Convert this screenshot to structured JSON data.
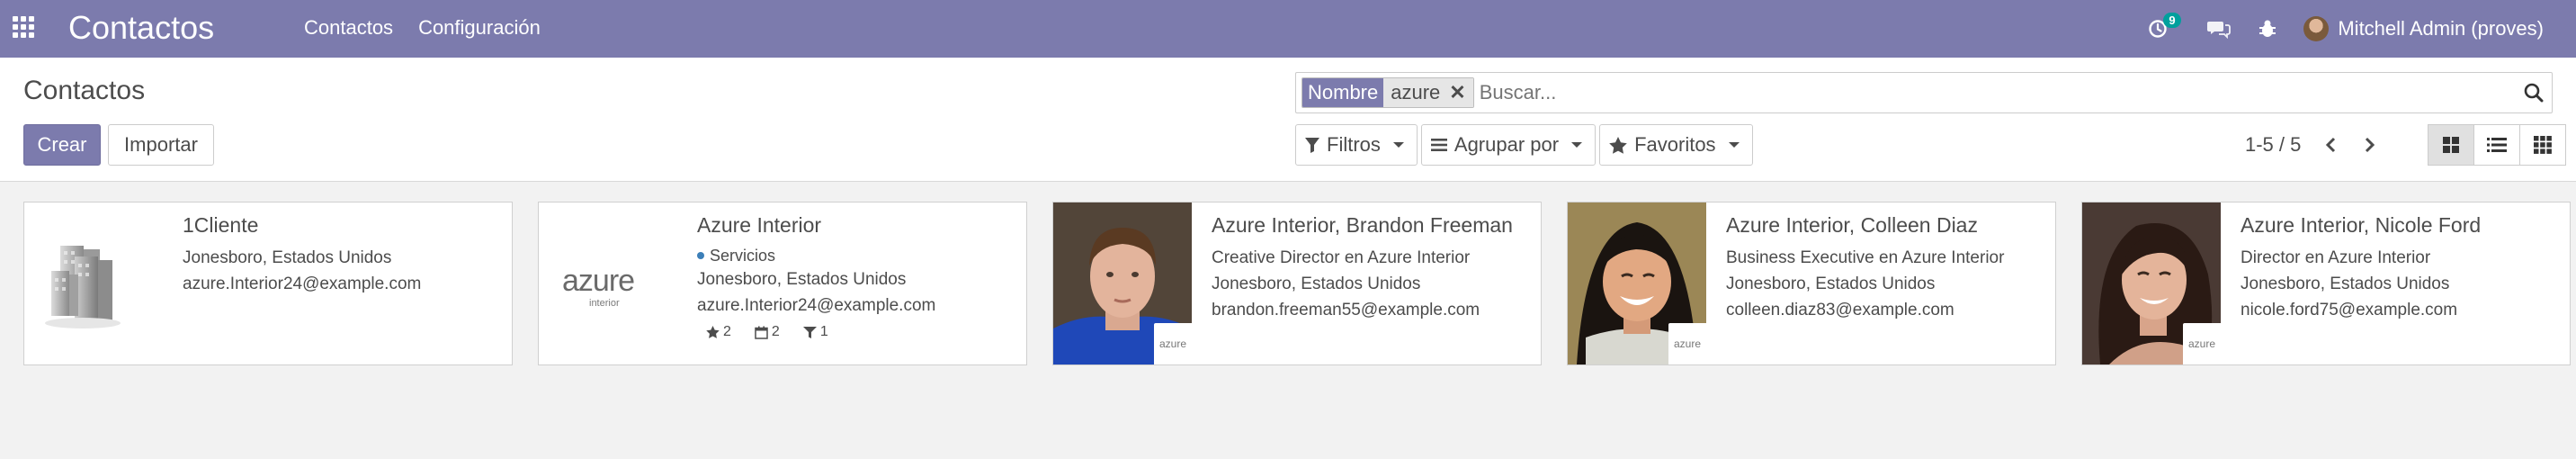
{
  "navbar": {
    "brand": "Contactos",
    "menu": [
      "Contactos",
      "Configuración"
    ],
    "activity_badge": "9",
    "user_name": "Mitchell Admin (proves)"
  },
  "control_panel": {
    "breadcrumb": "Contactos",
    "create_label": "Crear",
    "import_label": "Importar",
    "search": {
      "facet_label": "Nombre",
      "facet_value": "azure",
      "placeholder": "Buscar..."
    },
    "filters_label": "Filtros",
    "group_by_label": "Agrupar por",
    "favorites_label": "Favoritos",
    "pager": "1-5 / 5"
  },
  "colors": {
    "brand": "#7c7bad",
    "tag_blue": "#3c7fb8",
    "badge": "#00a09d"
  },
  "cards": [
    {
      "title": "1Cliente",
      "lines": [
        "Jonesboro, Estados Unidos",
        "azure.Interior24@example.com"
      ],
      "image": "buildings-icon"
    },
    {
      "title": "Azure Interior",
      "tag": "Servicios",
      "lines": [
        "Jonesboro, Estados Unidos",
        "azure.Interior24@example.com"
      ],
      "stats": {
        "stars": "2",
        "meetings": "2",
        "opportunities": "1"
      },
      "image": "azure-logo"
    },
    {
      "title": "Azure Interior, Brandon Freeman",
      "lines": [
        "Creative Director en Azure Interior",
        "Jonesboro, Estados Unidos",
        "brandon.freeman55@example.com"
      ],
      "image": "person-photo"
    },
    {
      "title": "Azure Interior, Colleen Diaz",
      "lines": [
        "Business Executive en Azure Interior",
        "Jonesboro, Estados Unidos",
        "colleen.diaz83@example.com"
      ],
      "image": "person-photo"
    },
    {
      "title": "Azure Interior, Nicole Ford",
      "lines": [
        "Director en Azure Interior",
        "Jonesboro, Estados Unidos",
        "nicole.ford75@example.com"
      ],
      "image": "person-photo"
    }
  ],
  "azure_logo_text": "azure",
  "azure_logo_sub": "interior"
}
